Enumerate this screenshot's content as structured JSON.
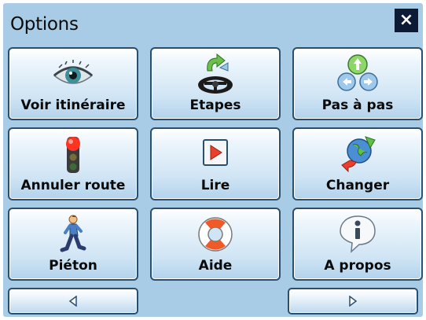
{
  "dialog": {
    "title": "Options",
    "close_label": "×"
  },
  "menu": {
    "items": [
      {
        "label": "Voir itinéraire",
        "icon": "eye-icon"
      },
      {
        "label": "Etapes",
        "icon": "steering-wheel-icon"
      },
      {
        "label": "Pas à pas",
        "icon": "step-arrows-icon"
      },
      {
        "label": "Annuler route",
        "icon": "traffic-light-icon"
      },
      {
        "label": "Lire",
        "icon": "play-icon"
      },
      {
        "label": "Changer",
        "icon": "globe-arrows-icon"
      },
      {
        "label": "Piéton",
        "icon": "pedestrian-icon"
      },
      {
        "label": "Aide",
        "icon": "lifebuoy-icon"
      },
      {
        "label": "A propos",
        "icon": "info-icon"
      }
    ]
  },
  "nav": {
    "prev_icon": "triangle-left-icon",
    "next_icon": "triangle-right-icon"
  }
}
